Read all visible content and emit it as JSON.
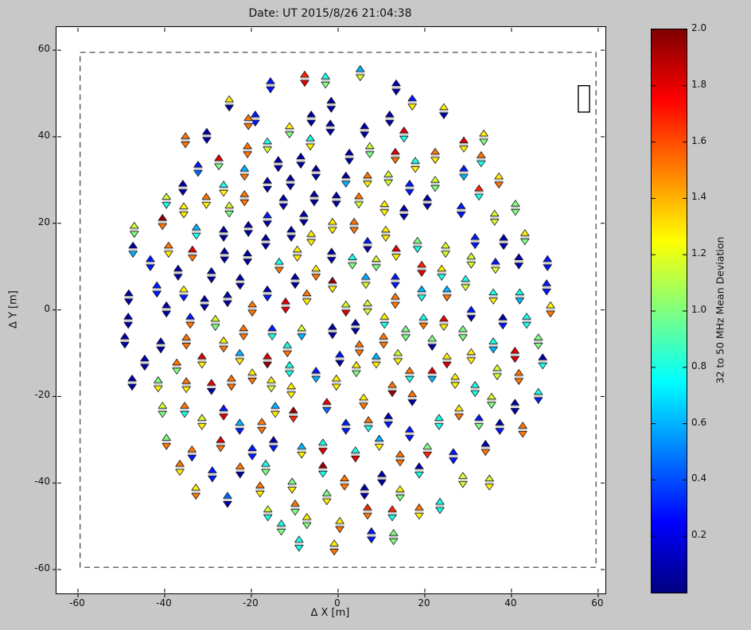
{
  "title": "Date: UT 2015/8/26 21:04:38",
  "chart_data": {
    "type": "scatter",
    "title": "Date: UT 2015/8/26 21:04:38",
    "xlabel": "∆ X [m]",
    "ylabel": "∆ Y [m]",
    "xlim": [
      -64.9,
      61.6
    ],
    "ylim": [
      -65.3,
      60.4
    ],
    "x_ticks": [
      -60,
      -40,
      -20,
      0,
      20,
      40,
      60
    ],
    "y_ticks": [
      60,
      40,
      20,
      0,
      -20,
      -40,
      -60
    ],
    "grid": false,
    "marker_style": "each antenna stand drawn as a vertical pair: up-triangle above, down-triangle below, independently colored",
    "colorbar": {
      "label": "32 to 50 MHz Mean Deviation",
      "range": [
        0,
        2
      ],
      "ticks": [
        0.2,
        0.4,
        0.6,
        0.8,
        1.0,
        1.2,
        1.4,
        1.6,
        1.8,
        2.0
      ],
      "colormap": "jet",
      "position": "right"
    },
    "dashed_boundary": {
      "x_range": [
        -59.5,
        59.5
      ],
      "y_range": [
        -59.5,
        59.5
      ]
    },
    "annotation_rect": {
      "x_range": [
        55.4,
        58.0
      ],
      "y_range": [
        45.7,
        51.8
      ]
    },
    "points_format": [
      "x_m",
      "y_m",
      "value_up_triangle",
      "value_down_triangle"
    ],
    "points": [
      [
        -15.6,
        51.9,
        0.3,
        0.3
      ],
      [
        -7.7,
        53.4,
        1.68,
        1.8
      ],
      [
        -2.9,
        53,
        0.8,
        1.0
      ],
      [
        -25.1,
        47.7,
        1.28,
        0.08
      ],
      [
        -19.1,
        44.2,
        0.3,
        0.3
      ],
      [
        -6.2,
        44.2,
        0.08,
        0.08
      ],
      [
        -11.2,
        41.5,
        1.28,
        1.0
      ],
      [
        -20.7,
        43.4,
        1.52,
        1.52
      ],
      [
        -35.2,
        39.2,
        1.52,
        1.52
      ],
      [
        -30.3,
        40.2,
        0.08,
        0.08
      ],
      [
        -16.3,
        38,
        0.8,
        1.16
      ],
      [
        -6.4,
        38.7,
        0.8,
        1.28
      ],
      [
        -20.9,
        36.9,
        1.52,
        1.52
      ],
      [
        -27.5,
        34.1,
        1.8,
        1.0
      ],
      [
        -32.3,
        32.6,
        0.3,
        0.45
      ],
      [
        -21.6,
        31.7,
        0.6,
        1.52
      ],
      [
        -13.8,
        33.7,
        0.08,
        0.08
      ],
      [
        -8.6,
        34.5,
        0.08,
        0.08
      ],
      [
        -16.3,
        28.9,
        0.08,
        0.08
      ],
      [
        -11,
        29.5,
        0.08,
        0.08
      ],
      [
        -5.1,
        31.7,
        0.08,
        0.08
      ],
      [
        -35.8,
        28.2,
        0.08,
        0.08
      ],
      [
        -39.6,
        25.2,
        1.16,
        0.8
      ],
      [
        -30.4,
        25.2,
        1.52,
        1.28
      ],
      [
        -26.4,
        28,
        0.8,
        1.28
      ],
      [
        -21.6,
        25.8,
        1.52,
        1.52
      ],
      [
        -12.6,
        24.9,
        0.08,
        0.08
      ],
      [
        -5.5,
        25.8,
        0.08,
        0.08
      ],
      [
        -35.6,
        23,
        1.28,
        1.28
      ],
      [
        -25.1,
        23.2,
        1.16,
        1.0
      ],
      [
        5.1,
        54.7,
        0.6,
        1.16
      ],
      [
        13.4,
        51.4,
        0.08,
        0.08
      ],
      [
        17.1,
        47.9,
        0.3,
        1.28
      ],
      [
        24.4,
        45.9,
        1.28,
        0.08
      ],
      [
        -1.6,
        47.4,
        0.08,
        0.08
      ],
      [
        -1.8,
        42.1,
        0.08,
        0.08
      ],
      [
        11.9,
        44.2,
        0.08,
        0.08
      ],
      [
        6.1,
        41.5,
        0.08,
        0.08
      ],
      [
        15.2,
        40.5,
        1.8,
        0.8
      ],
      [
        7.3,
        36.9,
        1.16,
        1.0
      ],
      [
        2.6,
        35.4,
        0.08,
        0.08
      ],
      [
        13.2,
        35.6,
        1.8,
        1.52
      ],
      [
        17.8,
        33.5,
        0.8,
        1.28
      ],
      [
        22.4,
        35.6,
        1.52,
        1.28
      ],
      [
        29,
        38.2,
        1.8,
        1.28
      ],
      [
        1.8,
        30.1,
        0.08,
        0.6
      ],
      [
        6.8,
        30.1,
        1.52,
        1.28
      ],
      [
        11.6,
        30.4,
        1.16,
        1.16
      ],
      [
        16.5,
        28.2,
        0.3,
        0.3
      ],
      [
        22.4,
        29.1,
        1.16,
        1.0
      ],
      [
        29,
        31.7,
        0.3,
        0.6
      ],
      [
        -0.4,
        25.5,
        0.08,
        0.08
      ],
      [
        4.8,
        25.3,
        1.52,
        1.16
      ],
      [
        10.7,
        23.5,
        1.28,
        1.28
      ],
      [
        15.2,
        22.5,
        0.08,
        0.08
      ],
      [
        20.6,
        24.9,
        0.08,
        0.08
      ],
      [
        28.4,
        23,
        0.3,
        0.3
      ],
      [
        33.6,
        39.8,
        1.28,
        1.0
      ],
      [
        33,
        34.8,
        1.52,
        0.8
      ],
      [
        37.1,
        29.9,
        1.28,
        1.52
      ],
      [
        32.5,
        27.1,
        1.68,
        0.8
      ],
      [
        40.9,
        23.6,
        1.0,
        1.0
      ],
      [
        36.1,
        21.3,
        1.16,
        1.16
      ],
      [
        -47,
        18.5,
        1.16,
        1.0
      ],
      [
        -40.5,
        20.3,
        1.95,
        1.52
      ],
      [
        -32.7,
        18.1,
        0.6,
        0.8
      ],
      [
        -26.4,
        17.6,
        0.08,
        0.08
      ],
      [
        -20.7,
        18.7,
        0.08,
        0.08
      ],
      [
        -16.3,
        20.9,
        0.3,
        0.08
      ],
      [
        -7.9,
        21.2,
        0.08,
        0.08
      ],
      [
        -16.7,
        15.7,
        0.08,
        0.08
      ],
      [
        -10.8,
        17.6,
        0.08,
        0.08
      ],
      [
        -6.2,
        16.6,
        1.28,
        1.28
      ],
      [
        -47.3,
        13.9,
        0.08,
        0.6
      ],
      [
        -39.1,
        13.9,
        1.52,
        1.28
      ],
      [
        -33.6,
        13,
        1.8,
        1.52
      ],
      [
        -26.2,
        12.6,
        0.08,
        0.08
      ],
      [
        -20.9,
        12.1,
        0.08,
        0.08
      ],
      [
        -13.6,
        10.2,
        0.8,
        1.52
      ],
      [
        -9.4,
        13,
        1.28,
        1.28
      ],
      [
        -5.1,
        8.6,
        1.28,
        1.52
      ],
      [
        -43.3,
        10.8,
        0.3,
        0.3
      ],
      [
        -36.9,
        8.6,
        0.08,
        0.08
      ],
      [
        -29.2,
        8,
        0.08,
        0.08
      ],
      [
        -22.6,
        6.5,
        0.08,
        0.08
      ],
      [
        -9.9,
        6.7,
        0.08,
        0.08
      ],
      [
        -41.8,
        4.7,
        0.3,
        0.3
      ],
      [
        -35.6,
        3.8,
        1.28,
        0.3
      ],
      [
        -48.3,
        2.9,
        0.08,
        0.08
      ],
      [
        -30.8,
        1.6,
        0.08,
        0.08
      ],
      [
        -25.5,
        2.5,
        0.08,
        0.08
      ],
      [
        -16.3,
        3.8,
        0.08,
        0.3
      ],
      [
        -12.1,
        1,
        1.8,
        1.8
      ],
      [
        -7.2,
        2.9,
        1.52,
        1.28
      ],
      [
        -19.8,
        0.3,
        1.52,
        1.52
      ],
      [
        -39.6,
        0.1,
        0.08,
        0.08
      ],
      [
        -48.4,
        -2.5,
        0.08,
        0.08
      ],
      [
        -34.1,
        -2.5,
        0.3,
        1.52
      ],
      [
        -28.3,
        -3,
        1.16,
        1.0
      ],
      [
        -21.8,
        -5.2,
        1.52,
        1.52
      ],
      [
        -15.2,
        -5.2,
        0.3,
        0.8
      ],
      [
        -8.4,
        -5.2,
        1.16,
        0.6
      ],
      [
        -49.2,
        -7.1,
        0.08,
        0.08
      ],
      [
        -40.9,
        -8.2,
        0.08,
        0.08
      ],
      [
        -35,
        -7.3,
        1.52,
        1.52
      ],
      [
        -26.4,
        -8,
        1.28,
        1.52
      ],
      [
        -11.7,
        -9.1,
        0.8,
        1.52
      ],
      [
        -44.6,
        -12.2,
        0.08,
        0.08
      ],
      [
        -37.2,
        -13.1,
        1.52,
        1.0
      ],
      [
        -31.4,
        -11.7,
        1.8,
        1.28
      ],
      [
        -22.7,
        -10.9,
        0.6,
        1.28
      ],
      [
        -16.3,
        -11.7,
        1.8,
        1.95
      ],
      [
        -11.2,
        -13.7,
        0.8,
        0.8
      ],
      [
        -5.1,
        -15,
        0.3,
        0.6
      ],
      [
        -47.5,
        -16.8,
        0.08,
        0.08
      ],
      [
        -41.5,
        -17.2,
        1.0,
        1.28
      ],
      [
        -35,
        -17.4,
        1.52,
        1.28
      ],
      [
        -29.2,
        -17.8,
        1.8,
        0.08
      ],
      [
        -24.6,
        -16.8,
        1.52,
        1.52
      ],
      [
        -19.8,
        -15.4,
        1.28,
        1.52
      ],
      [
        -15.4,
        -17.2,
        1.28,
        1.16
      ],
      [
        -10.8,
        -18.6,
        1.28,
        1.28
      ],
      [
        -1.5,
        12.5,
        0.08,
        0.08
      ],
      [
        -1.3,
        19.4,
        1.28,
        1.28
      ],
      [
        3.7,
        19.4,
        1.52,
        1.52
      ],
      [
        11,
        17.6,
        1.28,
        1.28
      ],
      [
        6.8,
        15,
        0.3,
        0.08
      ],
      [
        18.3,
        15,
        1.0,
        0.8
      ],
      [
        13.4,
        13.2,
        1.8,
        1.28
      ],
      [
        24.8,
        13.9,
        1.16,
        1.16
      ],
      [
        31.6,
        15.9,
        0.3,
        0.3
      ],
      [
        38.2,
        15.7,
        0.08,
        0.08
      ],
      [
        43.1,
        16.8,
        1.28,
        1.0
      ],
      [
        3.3,
        11.2,
        0.8,
        1.0
      ],
      [
        8.8,
        10.8,
        1.16,
        1.0
      ],
      [
        19.3,
        9.5,
        1.68,
        1.8
      ],
      [
        23.9,
        8.6,
        1.28,
        0.8
      ],
      [
        30.7,
        11.4,
        1.16,
        1.16
      ],
      [
        36.3,
        10.2,
        0.3,
        1.16
      ],
      [
        41.7,
        11.2,
        0.08,
        0.08
      ],
      [
        48.3,
        10.8,
        0.3,
        0.3
      ],
      [
        -1.3,
        5.8,
        1.95,
        1.28
      ],
      [
        6.4,
        6.7,
        0.6,
        1.16
      ],
      [
        13.2,
        6.7,
        0.3,
        0.3
      ],
      [
        29.4,
        6.2,
        0.8,
        1.16
      ],
      [
        48.1,
        5.2,
        0.3,
        0.3
      ],
      [
        19.3,
        3.8,
        0.6,
        0.8
      ],
      [
        25.1,
        3.8,
        0.6,
        1.52
      ],
      [
        13.2,
        2.1,
        1.52,
        1.52
      ],
      [
        35.8,
        3.1,
        0.8,
        1.28
      ],
      [
        41.9,
        3.1,
        0.8,
        0.6
      ],
      [
        1.8,
        0.3,
        1.16,
        1.8
      ],
      [
        6.8,
        0.6,
        1.16,
        1.16
      ],
      [
        49,
        0.1,
        1.28,
        1.52
      ],
      [
        30.7,
        -0.9,
        0.3,
        0.08
      ],
      [
        10.7,
        -2.5,
        1.28,
        0.8
      ],
      [
        19.7,
        -2.7,
        0.8,
        1.52
      ],
      [
        24.4,
        -3,
        1.8,
        1.28
      ],
      [
        38,
        -2.7,
        0.08,
        0.3
      ],
      [
        43.5,
        -2.5,
        0.8,
        0.8
      ],
      [
        -1.3,
        -4.9,
        0.08,
        0.08
      ],
      [
        4,
        -3.9,
        0.08,
        0.08
      ],
      [
        15.6,
        -5.4,
        1.0,
        1.0
      ],
      [
        28.8,
        -5.4,
        1.0,
        1.0
      ],
      [
        10.5,
        -7.1,
        1.52,
        1.52
      ],
      [
        21.7,
        -7.6,
        1.0,
        0.08
      ],
      [
        35.8,
        -8.2,
        0.8,
        0.6
      ],
      [
        46.2,
        -7.3,
        1.0,
        1.0
      ],
      [
        4.9,
        -8.9,
        1.52,
        1.52
      ],
      [
        40.8,
        -10.4,
        1.8,
        1.8
      ],
      [
        0.4,
        -11.3,
        0.3,
        0.08
      ],
      [
        8.8,
        -11.7,
        0.6,
        1.28
      ],
      [
        13.8,
        -10.9,
        1.16,
        1.28
      ],
      [
        25.1,
        -11.7,
        1.28,
        1.8
      ],
      [
        30.7,
        -10.7,
        1.28,
        1.28
      ],
      [
        47.2,
        -11.9,
        0.08,
        0.8
      ],
      [
        4.2,
        -13.7,
        1.28,
        1.0
      ],
      [
        16.5,
        -15,
        1.52,
        0.8
      ],
      [
        21.7,
        -15,
        1.8,
        0.6
      ],
      [
        36.7,
        -14.4,
        1.16,
        1.16
      ],
      [
        41.7,
        -15.5,
        1.52,
        1.52
      ],
      [
        -0.4,
        -16.8,
        1.28,
        1.28
      ],
      [
        27,
        -16.4,
        1.28,
        1.28
      ],
      [
        31.6,
        -18.3,
        0.8,
        0.8
      ],
      [
        12.5,
        -18.3,
        1.52,
        1.95
      ],
      [
        46.2,
        -19.9,
        0.8,
        0.3
      ],
      [
        -40.5,
        -23.1,
        1.16,
        1.0
      ],
      [
        -35.4,
        -23.1,
        1.52,
        0.8
      ],
      [
        -26.4,
        -23.7,
        0.3,
        1.8
      ],
      [
        -31.4,
        -25.9,
        1.16,
        1.28
      ],
      [
        -22.7,
        -27,
        0.6,
        0.3
      ],
      [
        -17.6,
        -26.8,
        1.52,
        1.52
      ],
      [
        -14.5,
        -23.1,
        0.6,
        1.28
      ],
      [
        -10.3,
        -24.2,
        1.95,
        1.68
      ],
      [
        -2.6,
        -22.2,
        1.8,
        0.45
      ],
      [
        -39.6,
        -30.5,
        1.0,
        1.52
      ],
      [
        -27.1,
        -31,
        1.8,
        1.52
      ],
      [
        -33.7,
        -33.2,
        1.52,
        0.3
      ],
      [
        -19.8,
        -32.9,
        0.3,
        0.3
      ],
      [
        -14.9,
        -31,
        0.08,
        0.3
      ],
      [
        -8.4,
        -32.5,
        0.6,
        1.28
      ],
      [
        -3.5,
        -31.6,
        0.8,
        1.8
      ],
      [
        -36.5,
        -36.5,
        1.52,
        1.28
      ],
      [
        -29,
        -38,
        0.3,
        0.3
      ],
      [
        -22.6,
        -37.1,
        1.52,
        0.08
      ],
      [
        -16.7,
        -36.5,
        0.8,
        1.0
      ],
      [
        -3.5,
        -36.9,
        1.95,
        0.8
      ],
      [
        -32.8,
        -42,
        1.28,
        1.52
      ],
      [
        -25.5,
        -43.9,
        0.45,
        0.08
      ],
      [
        -18,
        -41.5,
        1.52,
        1.28
      ],
      [
        -10.6,
        -40.6,
        1.0,
        1.28
      ],
      [
        -16.2,
        -47,
        1.16,
        0.8
      ],
      [
        -9.9,
        -45.7,
        1.52,
        1.0
      ],
      [
        -7.2,
        -48.8,
        1.28,
        1.0
      ],
      [
        -13.1,
        -50.3,
        0.8,
        1.0
      ],
      [
        -9,
        -54,
        0.8,
        0.8
      ],
      [
        -2.6,
        -43.3,
        1.0,
        1.28
      ],
      [
        5.9,
        -21.2,
        1.28,
        1.52
      ],
      [
        17.1,
        -20.4,
        1.52,
        0.08
      ],
      [
        1.8,
        -27,
        0.3,
        0.3
      ],
      [
        7,
        -26.4,
        1.52,
        0.8
      ],
      [
        11.6,
        -25.5,
        0.08,
        0.3
      ],
      [
        23.3,
        -25.9,
        0.8,
        0.8
      ],
      [
        27.9,
        -23.7,
        1.28,
        1.52
      ],
      [
        32.5,
        -25.9,
        0.3,
        1.0
      ],
      [
        37.3,
        -27,
        0.08,
        0.3
      ],
      [
        42.6,
        -27.7,
        1.52,
        1.52
      ],
      [
        35.4,
        -21,
        1.16,
        1.0
      ],
      [
        40.8,
        -22.4,
        0.08,
        0.08
      ],
      [
        16.5,
        -28.6,
        0.3,
        0.3
      ],
      [
        9.5,
        -30.7,
        0.6,
        1.28
      ],
      [
        4,
        -33.4,
        0.8,
        1.8
      ],
      [
        14.3,
        -34.3,
        1.52,
        1.52
      ],
      [
        20.6,
        -32.5,
        1.0,
        1.68
      ],
      [
        26.6,
        -33.8,
        0.3,
        0.3
      ],
      [
        34,
        -31.9,
        0.08,
        1.52
      ],
      [
        18.7,
        -37.1,
        0.08,
        0.8
      ],
      [
        10.1,
        -38.9,
        0.08,
        0.08
      ],
      [
        1.5,
        -39.9,
        1.52,
        1.52
      ],
      [
        28.8,
        -39.3,
        1.16,
        1.16
      ],
      [
        34.9,
        -39.9,
        1.16,
        1.28
      ],
      [
        6.1,
        -42,
        0.08,
        0.08
      ],
      [
        14.3,
        -42.4,
        1.28,
        1.0
      ],
      [
        23.5,
        -45.3,
        0.8,
        0.8
      ],
      [
        6.8,
        -46.6,
        1.68,
        1.52
      ],
      [
        12.5,
        -47,
        1.68,
        0.8
      ],
      [
        18.7,
        -46.6,
        1.52,
        1.28
      ],
      [
        0.4,
        -49.7,
        1.28,
        1.52
      ],
      [
        7.7,
        -52.1,
        0.3,
        0.3
      ],
      [
        12.8,
        -52.5,
        1.0,
        1.0
      ],
      [
        -0.9,
        -54.9,
        1.28,
        1.52
      ]
    ]
  }
}
